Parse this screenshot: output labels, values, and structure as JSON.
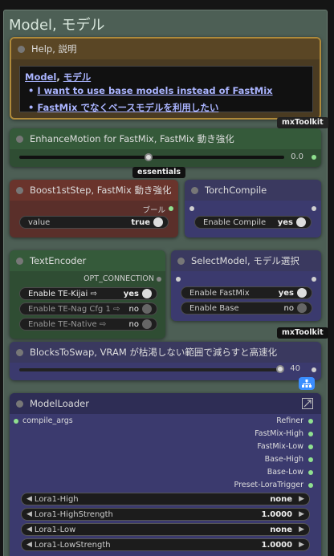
{
  "group": {
    "title": "Model, モデル"
  },
  "help": {
    "title": "Help, 説明",
    "heading_a": "Model",
    "heading_sep": ", ",
    "heading_b": "モデル",
    "items": [
      "I want to use base models instead of FastMix",
      "FastMix でなくベースモデルを利用したい"
    ],
    "badge": "mxToolkit"
  },
  "enhance": {
    "title": "EnhanceMotion for FastMix, FastMix 動き強化",
    "value": "0.0",
    "badge": "essentials"
  },
  "boost": {
    "title": "Boost1stStep, FastMix 動き強化",
    "output_label": "ブール",
    "widget_label": "value",
    "widget_value": "true"
  },
  "torch": {
    "title": "TorchCompile",
    "widget_label": "Enable Compile",
    "widget_value": "yes"
  },
  "textenc": {
    "title": "TextEncoder",
    "output_label": "OPT_CONNECTION",
    "widgets": [
      {
        "label": "Enable TE-Kijai ⇨",
        "value": "yes"
      },
      {
        "label": "Enable TE-Nag Cfg 1 ⇨",
        "value": "no"
      },
      {
        "label": "Enable TE-Native ⇨",
        "value": "no"
      }
    ]
  },
  "select": {
    "title": "SelectModel, モデル選択",
    "widgets": [
      {
        "label": "Enable FastMix",
        "value": "yes"
      },
      {
        "label": "Enable Base",
        "value": "no"
      }
    ],
    "badge": "mxToolkit"
  },
  "blocks": {
    "title": "BlocksToSwap, VRAM が枯渇しない範囲で減らすと高速化",
    "value": "40"
  },
  "loader": {
    "title": "ModelLoader",
    "input_label": "compile_args",
    "outputs": [
      "Refiner",
      "FastMix-High",
      "FastMix-Low",
      "Base-High",
      "Base-Low",
      "Preset-LoraTrigger"
    ],
    "combos": [
      {
        "label": "Lora1-High",
        "value": "none"
      },
      {
        "label": "Lora1-HighStrength",
        "value": "1.0000"
      },
      {
        "label": "Lora1-Low",
        "value": "none"
      },
      {
        "label": "Lora1-LowStrength",
        "value": "1.0000"
      }
    ]
  },
  "colors": {
    "group": "#4d5f55",
    "help_border": "#b08a3a",
    "green_node": "#2f4d33",
    "red_node": "#5a2f2a",
    "blue_node": "#3b3a6e",
    "link": "#3a8eff"
  }
}
